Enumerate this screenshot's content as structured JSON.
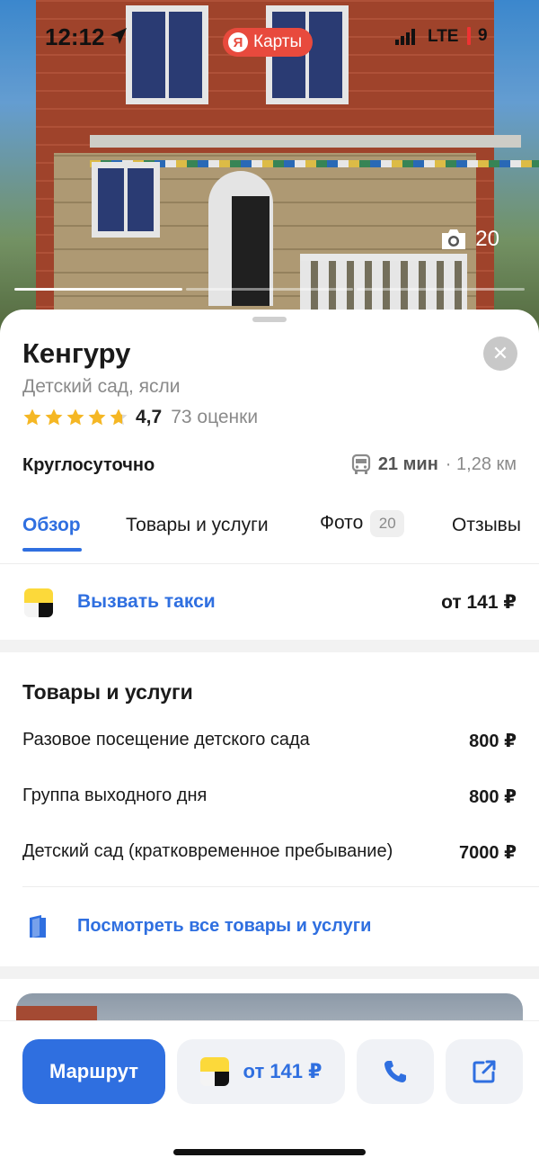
{
  "status_bar": {
    "time": "12:12",
    "app_pill_logo": "Я",
    "app_pill_label": "Карты",
    "network": "LTE",
    "battery_level": "9"
  },
  "hero": {
    "photo_count": "20"
  },
  "place": {
    "name": "Кенгуру",
    "category": "Детский сад, ясли",
    "rating_value": "4,7",
    "rating_stars": 4.7,
    "rating_count": "73 оценки",
    "hours": "Круглосуточно",
    "transit_time": "21 мин",
    "transit_distance": "· 1,28 км"
  },
  "tabs": [
    {
      "label": "Обзор",
      "active": true
    },
    {
      "label": "Товары и услуги",
      "active": false
    },
    {
      "label": "Фото",
      "badge": "20",
      "active": false
    },
    {
      "label": "Отзывы",
      "active": false
    }
  ],
  "taxi": {
    "label": "Вызвать такси",
    "price": "от 141 ₽"
  },
  "services": {
    "title": "Товары и услуги",
    "items": [
      {
        "name": "Разовое посещение детского сада",
        "price": "800 ₽"
      },
      {
        "name": "Группа выходного дня",
        "price": "800 ₽"
      },
      {
        "name": "Детский сад (кратковременное пребывание)",
        "price": "7000 ₽"
      }
    ],
    "view_all": "Посмотреть все товары и услуги"
  },
  "actions": {
    "route": "Маршрут",
    "taxi_price": "от 141 ₽"
  },
  "colors": {
    "accent": "#2f6fe0",
    "star": "#f5b724",
    "taxi_yellow": "#fcd93a",
    "pill_red": "#e84a3d"
  },
  "icons": {
    "location": "location-arrow-icon",
    "camera": "camera-icon",
    "close": "close-icon",
    "bus": "bus-icon",
    "book": "book-icon",
    "phone": "phone-icon",
    "share": "share-icon"
  }
}
